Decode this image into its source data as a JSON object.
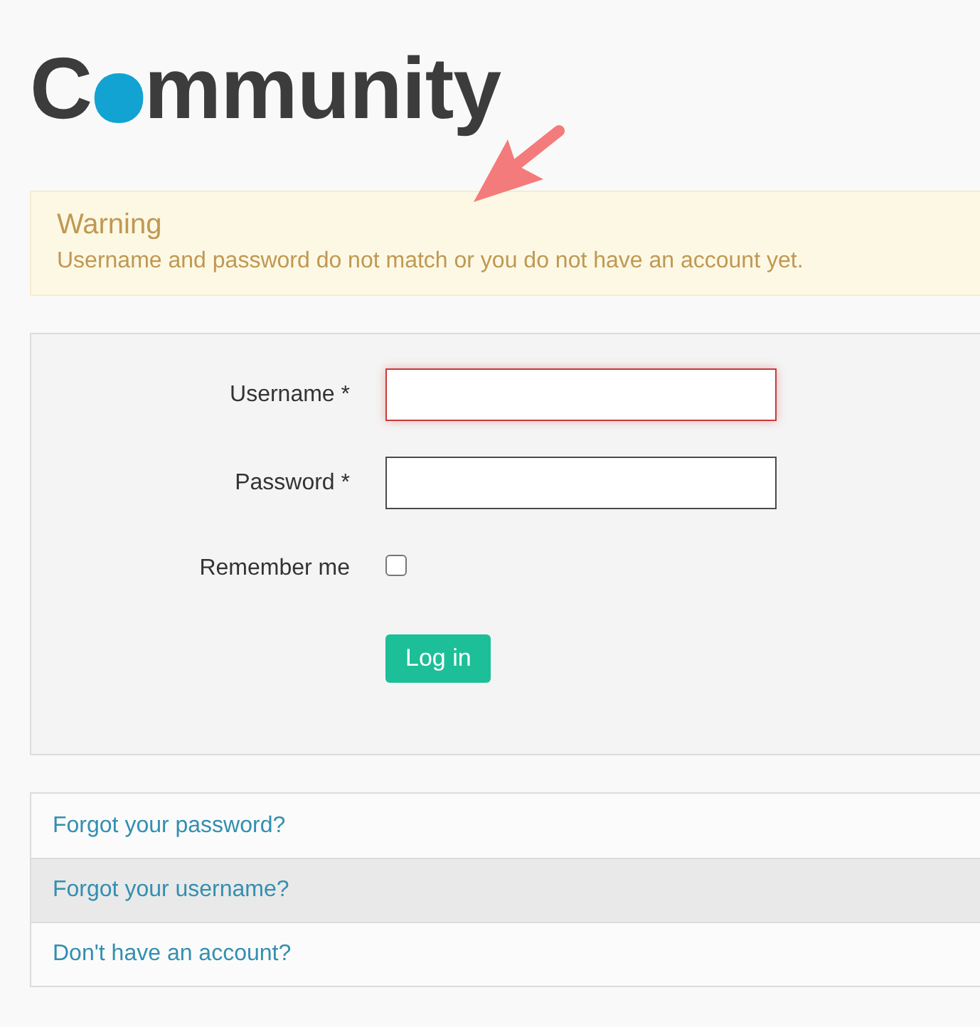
{
  "logo": {
    "text": "Community"
  },
  "alert": {
    "kind": "warning",
    "title": "Warning",
    "message": "Username and password do not match or you do not have an account yet."
  },
  "form": {
    "fields": [
      {
        "kind": "text",
        "label": "Username *",
        "error": true
      },
      {
        "kind": "password",
        "label": "Password *",
        "error": false
      },
      {
        "kind": "checkbox",
        "label": "Remember me",
        "checked": false
      }
    ],
    "submit": "Log in"
  },
  "links": [
    {
      "label": "Forgot your password?",
      "highlighted": false
    },
    {
      "label": "Forgot your username?",
      "highlighted": true
    },
    {
      "label": "Don't have an account?",
      "highlighted": false
    }
  ]
}
